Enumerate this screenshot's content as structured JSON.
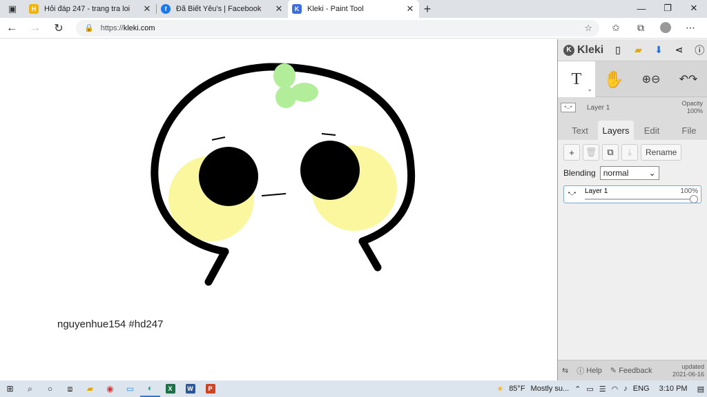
{
  "browser": {
    "tabs": [
      {
        "title": "Hỏi đáp 247 - trang tra loi",
        "favicon": "hoidap-icon",
        "active": false
      },
      {
        "title": "Đã Biết Yêu's | Facebook",
        "favicon": "facebook-icon",
        "active": false
      },
      {
        "title": "Kleki - Paint Tool",
        "favicon": "kleki-icon",
        "active": true
      }
    ],
    "url_scheme": "https://",
    "url_host": "kleki.com"
  },
  "canvas": {
    "signature": "nguyenhue154 #hd247"
  },
  "panel": {
    "logo": "Kleki",
    "layer_name": "Layer 1",
    "opacity_label": "Opacity",
    "opacity_value": "100%",
    "tabs": [
      "Text",
      "Layers",
      "Edit",
      "File"
    ],
    "active_tab": "Layers",
    "rename_label": "Rename",
    "blending_label": "Blending",
    "blending_value": "normal",
    "layer_row": {
      "name": "Layer 1",
      "opacity": "100%"
    },
    "help_label": "Help",
    "feedback_label": "Feedback",
    "updated_label": "updated",
    "updated_date": "2021-06-16"
  },
  "taskbar": {
    "weather_temp": "85°F",
    "weather_text": "Mostly su...",
    "language": "ENG",
    "time": "3:10 PM"
  },
  "colors": {
    "cheek": "#fbf79e",
    "sprout": "#b2ee9a",
    "accent": "#2a7bd5"
  }
}
